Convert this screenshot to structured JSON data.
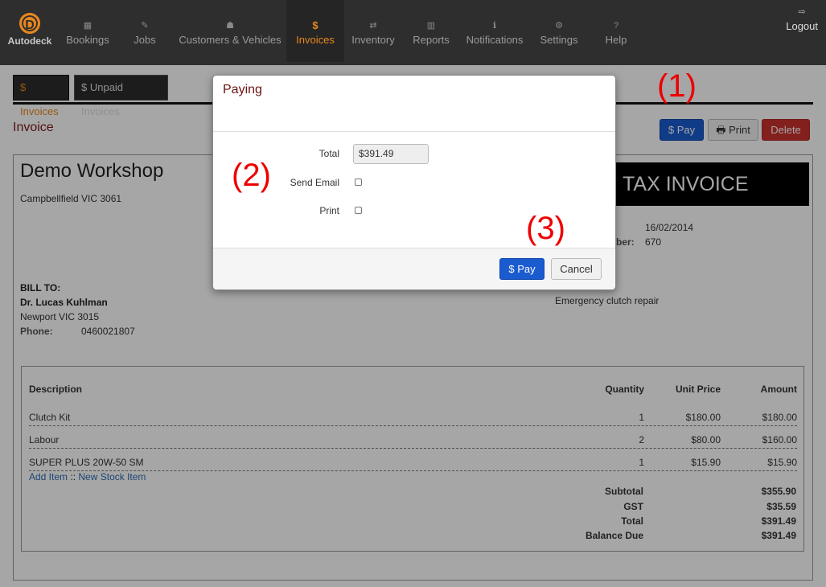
{
  "nav": {
    "brand": "Autodeck",
    "items": [
      {
        "label": "Bookings",
        "icon": "calendar-icon",
        "glyph": "▦"
      },
      {
        "label": "Jobs",
        "icon": "wrench-icon",
        "glyph": "✎"
      },
      {
        "label": "Customers & Vehicles",
        "icon": "users-icon",
        "glyph": "☗"
      },
      {
        "label": "Invoices",
        "icon": "dollar-icon",
        "glyph": "$"
      },
      {
        "label": "Inventory",
        "icon": "exchange-icon",
        "glyph": "⇄"
      },
      {
        "label": "Reports",
        "icon": "bar-chart-icon",
        "glyph": "▥"
      },
      {
        "label": "Notifications",
        "icon": "info-icon",
        "glyph": "ℹ"
      },
      {
        "label": "Settings",
        "icon": "gears-icon",
        "glyph": "⚙"
      },
      {
        "label": "Help",
        "icon": "question-icon",
        "glyph": "?"
      }
    ],
    "logout": "Logout"
  },
  "tabs": {
    "invoices": "$ Invoices",
    "unpaid": "$ Unpaid Invoices"
  },
  "page": {
    "title": "Invoice"
  },
  "actions": {
    "pay": "$ Pay",
    "print": "🖶 Print",
    "delete": "Delete"
  },
  "invoice": {
    "workshop": "Demo Workshop",
    "address": "Campbellfield VIC 3061",
    "doc_title": "TAX INVOICE",
    "date": "16/02/2014",
    "number_label_partial": "ber:",
    "number": "670",
    "bill_to_label": "BILL TO:",
    "customer": "Dr. Lucas Kuhlman",
    "customer_address": "Newport VIC 3015",
    "phone_label": "Phone:",
    "phone": "0460021807",
    "job_description": "Emergency clutch repair"
  },
  "table": {
    "headers": {
      "description": "Description",
      "quantity": "Quantity",
      "unit_price": "Unit Price",
      "amount": "Amount"
    },
    "rows": [
      {
        "description": "Clutch Kit",
        "quantity": "1",
        "unit_price": "$180.00",
        "amount": "$180.00"
      },
      {
        "description": "Labour",
        "quantity": "2",
        "unit_price": "$80.00",
        "amount": "$160.00"
      },
      {
        "description": "SUPER PLUS 20W-50 SM",
        "quantity": "1",
        "unit_price": "$15.90",
        "amount": "$15.90"
      }
    ],
    "add_item": "Add Item",
    "separator": "::",
    "new_stock_item": "New Stock Item",
    "totals": [
      {
        "label": "Subtotal",
        "value": "$355.90"
      },
      {
        "label": "GST",
        "value": "$35.59"
      },
      {
        "label": "Total",
        "value": "$391.49"
      },
      {
        "label": "Balance Due",
        "value": "$391.49"
      }
    ]
  },
  "modal": {
    "title": "Paying",
    "total_label": "Total",
    "total_value": "$391.49",
    "send_email_label": "Send Email",
    "print_label": "Print",
    "pay_button": "$ Pay",
    "cancel_button": "Cancel"
  },
  "annotations": {
    "one": "(1)",
    "two": "(2)",
    "three": "(3)"
  },
  "colors": {
    "accent": "#e8871e",
    "pay_blue": "#1a5bd0",
    "delete_red": "#c9302c",
    "annotation_red": "#ee0000",
    "title_maroon": "#7a1a1a"
  }
}
